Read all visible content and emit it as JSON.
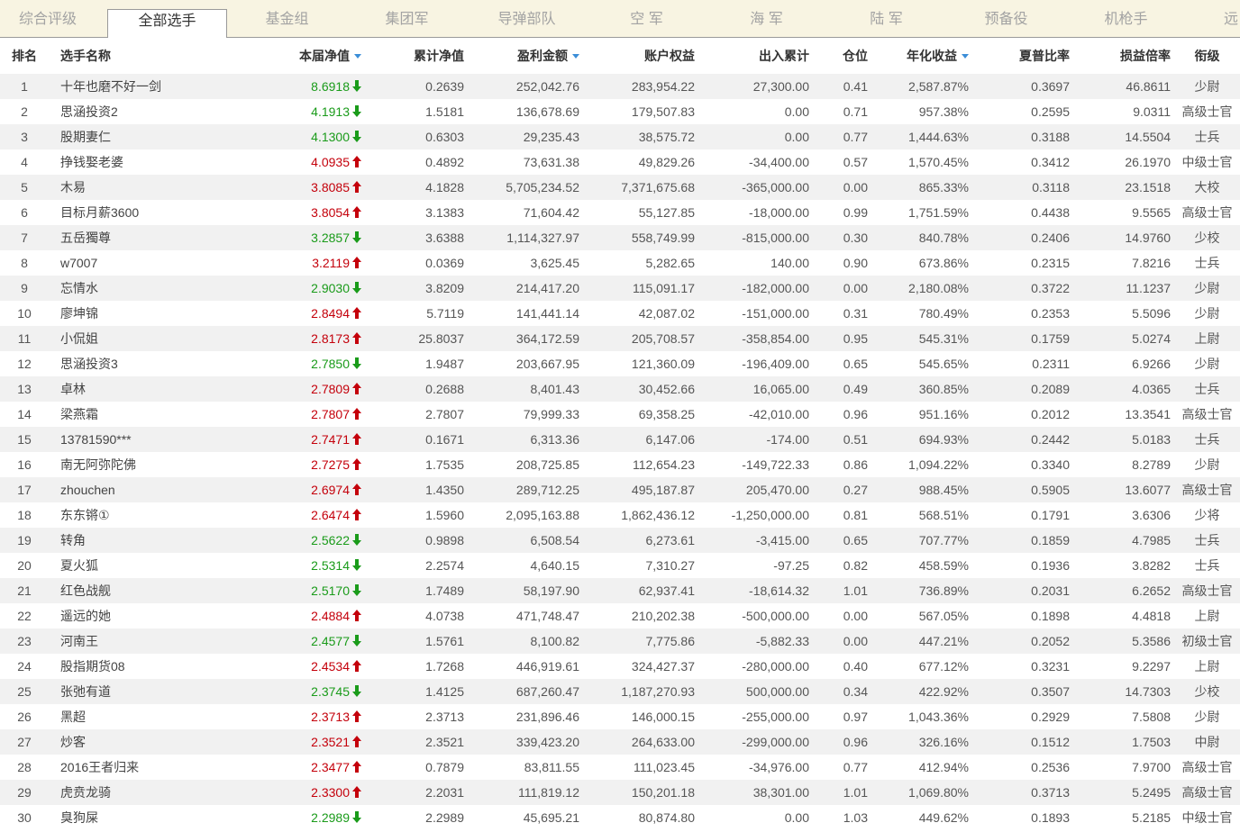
{
  "tabs": [
    {
      "label": "综合评级"
    },
    {
      "label": "全部选手",
      "active": true
    },
    {
      "label": "基金组"
    },
    {
      "label": "集团军"
    },
    {
      "label": "导弹部队"
    },
    {
      "label": "空 军"
    },
    {
      "label": "海 军"
    },
    {
      "label": "陆 军"
    },
    {
      "label": "预备役"
    },
    {
      "label": "机枪手"
    },
    {
      "label": "远"
    }
  ],
  "columns": [
    {
      "label": "排名"
    },
    {
      "label": "选手名称"
    },
    {
      "label": "本届净值",
      "sort": "desc"
    },
    {
      "label": "累计净值"
    },
    {
      "label": "盈利金额",
      "sort": "desc"
    },
    {
      "label": "账户权益"
    },
    {
      "label": "出入累计"
    },
    {
      "label": "仓位"
    },
    {
      "label": "年化收益",
      "sort": "desc"
    },
    {
      "label": "夏普比率"
    },
    {
      "label": "损益倍率"
    },
    {
      "label": "衔级"
    }
  ],
  "colors": {
    "up": "#c4000b",
    "down": "#1a9b1a",
    "sort_icon": "#3b8ed8",
    "tab_bar": "#f8f4e2"
  },
  "trend_icons": {
    "up": "arrow-up-icon",
    "down": "arrow-down-icon"
  },
  "sort_icon": "sort-desc-triangle-icon",
  "rows": [
    {
      "rank": "1",
      "name": "十年也磨不好一剑",
      "current_nav": "8.6918",
      "trend": "down",
      "cum_nav": "0.2639",
      "profit": "252,042.76",
      "equity": "283,954.22",
      "flow": "27,300.00",
      "position": "0.41",
      "annual": "2,587.87%",
      "sharpe": "0.3697",
      "pl_ratio": "46.8611",
      "title": "少尉"
    },
    {
      "rank": "2",
      "name": "思涵投资2",
      "current_nav": "4.1913",
      "trend": "down",
      "cum_nav": "1.5181",
      "profit": "136,678.69",
      "equity": "179,507.83",
      "flow": "0.00",
      "position": "0.71",
      "annual": "957.38%",
      "sharpe": "0.2595",
      "pl_ratio": "9.0311",
      "title": "高级士官"
    },
    {
      "rank": "3",
      "name": "股期妻仁",
      "current_nav": "4.1300",
      "trend": "down",
      "cum_nav": "0.6303",
      "profit": "29,235.43",
      "equity": "38,575.72",
      "flow": "0.00",
      "position": "0.77",
      "annual": "1,444.63%",
      "sharpe": "0.3188",
      "pl_ratio": "14.5504",
      "title": "士兵"
    },
    {
      "rank": "4",
      "name": "挣钱娶老婆",
      "current_nav": "4.0935",
      "trend": "up",
      "cum_nav": "0.4892",
      "profit": "73,631.38",
      "equity": "49,829.26",
      "flow": "-34,400.00",
      "position": "0.57",
      "annual": "1,570.45%",
      "sharpe": "0.3412",
      "pl_ratio": "26.1970",
      "title": "中级士官"
    },
    {
      "rank": "5",
      "name": "木易",
      "current_nav": "3.8085",
      "trend": "up",
      "cum_nav": "4.1828",
      "profit": "5,705,234.52",
      "equity": "7,371,675.68",
      "flow": "-365,000.00",
      "position": "0.00",
      "annual": "865.33%",
      "sharpe": "0.3118",
      "pl_ratio": "23.1518",
      "title": "大校"
    },
    {
      "rank": "6",
      "name": "目标月薪3600",
      "current_nav": "3.8054",
      "trend": "up",
      "cum_nav": "3.1383",
      "profit": "71,604.42",
      "equity": "55,127.85",
      "flow": "-18,000.00",
      "position": "0.99",
      "annual": "1,751.59%",
      "sharpe": "0.4438",
      "pl_ratio": "9.5565",
      "title": "高级士官"
    },
    {
      "rank": "7",
      "name": "五岳獨尊",
      "current_nav": "3.2857",
      "trend": "down",
      "cum_nav": "3.6388",
      "profit": "1,114,327.97",
      "equity": "558,749.99",
      "flow": "-815,000.00",
      "position": "0.30",
      "annual": "840.78%",
      "sharpe": "0.2406",
      "pl_ratio": "14.9760",
      "title": "少校"
    },
    {
      "rank": "8",
      "name": "w7007",
      "current_nav": "3.2119",
      "trend": "up",
      "cum_nav": "0.0369",
      "profit": "3,625.45",
      "equity": "5,282.65",
      "flow": "140.00",
      "position": "0.90",
      "annual": "673.86%",
      "sharpe": "0.2315",
      "pl_ratio": "7.8216",
      "title": "士兵"
    },
    {
      "rank": "9",
      "name": "忘情水",
      "current_nav": "2.9030",
      "trend": "down",
      "cum_nav": "3.8209",
      "profit": "214,417.20",
      "equity": "115,091.17",
      "flow": "-182,000.00",
      "position": "0.00",
      "annual": "2,180.08%",
      "sharpe": "0.3722",
      "pl_ratio": "11.1237",
      "title": "少尉"
    },
    {
      "rank": "10",
      "name": "廖坤锦",
      "current_nav": "2.8494",
      "trend": "up",
      "cum_nav": "5.7119",
      "profit": "141,441.14",
      "equity": "42,087.02",
      "flow": "-151,000.00",
      "position": "0.31",
      "annual": "780.49%",
      "sharpe": "0.2353",
      "pl_ratio": "5.5096",
      "title": "少尉"
    },
    {
      "rank": "11",
      "name": "小侃姐",
      "current_nav": "2.8173",
      "trend": "up",
      "cum_nav": "25.8037",
      "profit": "364,172.59",
      "equity": "205,708.57",
      "flow": "-358,854.00",
      "position": "0.95",
      "annual": "545.31%",
      "sharpe": "0.1759",
      "pl_ratio": "5.0274",
      "title": "上尉"
    },
    {
      "rank": "12",
      "name": "思涵投资3",
      "current_nav": "2.7850",
      "trend": "down",
      "cum_nav": "1.9487",
      "profit": "203,667.95",
      "equity": "121,360.09",
      "flow": "-196,409.00",
      "position": "0.65",
      "annual": "545.65%",
      "sharpe": "0.2311",
      "pl_ratio": "6.9266",
      "title": "少尉"
    },
    {
      "rank": "13",
      "name": "卓林",
      "current_nav": "2.7809",
      "trend": "up",
      "cum_nav": "0.2688",
      "profit": "8,401.43",
      "equity": "30,452.66",
      "flow": "16,065.00",
      "position": "0.49",
      "annual": "360.85%",
      "sharpe": "0.2089",
      "pl_ratio": "4.0365",
      "title": "士兵"
    },
    {
      "rank": "14",
      "name": "梁燕霜",
      "current_nav": "2.7807",
      "trend": "up",
      "cum_nav": "2.7807",
      "profit": "79,999.33",
      "equity": "69,358.25",
      "flow": "-42,010.00",
      "position": "0.96",
      "annual": "951.16%",
      "sharpe": "0.2012",
      "pl_ratio": "13.3541",
      "title": "高级士官"
    },
    {
      "rank": "15",
      "name": "13781590***",
      "current_nav": "2.7471",
      "trend": "up",
      "cum_nav": "0.1671",
      "profit": "6,313.36",
      "equity": "6,147.06",
      "flow": "-174.00",
      "position": "0.51",
      "annual": "694.93%",
      "sharpe": "0.2442",
      "pl_ratio": "5.0183",
      "title": "士兵"
    },
    {
      "rank": "16",
      "name": "南无阿弥陀佛",
      "current_nav": "2.7275",
      "trend": "up",
      "cum_nav": "1.7535",
      "profit": "208,725.85",
      "equity": "112,654.23",
      "flow": "-149,722.33",
      "position": "0.86",
      "annual": "1,094.22%",
      "sharpe": "0.3340",
      "pl_ratio": "8.2789",
      "title": "少尉"
    },
    {
      "rank": "17",
      "name": "zhouchen",
      "current_nav": "2.6974",
      "trend": "up",
      "cum_nav": "1.4350",
      "profit": "289,712.25",
      "equity": "495,187.87",
      "flow": "205,470.00",
      "position": "0.27",
      "annual": "988.45%",
      "sharpe": "0.5905",
      "pl_ratio": "13.6077",
      "title": "高级士官"
    },
    {
      "rank": "18",
      "name": "东东锵①",
      "current_nav": "2.6474",
      "trend": "up",
      "cum_nav": "1.5960",
      "profit": "2,095,163.88",
      "equity": "1,862,436.12",
      "flow": "-1,250,000.00",
      "position": "0.81",
      "annual": "568.51%",
      "sharpe": "0.1791",
      "pl_ratio": "3.6306",
      "title": "少将"
    },
    {
      "rank": "19",
      "name": "转角",
      "current_nav": "2.5622",
      "trend": "down",
      "cum_nav": "0.9898",
      "profit": "6,508.54",
      "equity": "6,273.61",
      "flow": "-3,415.00",
      "position": "0.65",
      "annual": "707.77%",
      "sharpe": "0.1859",
      "pl_ratio": "4.7985",
      "title": "士兵"
    },
    {
      "rank": "20",
      "name": "夏火狐",
      "current_nav": "2.5314",
      "trend": "down",
      "cum_nav": "2.2574",
      "profit": "4,640.15",
      "equity": "7,310.27",
      "flow": "-97.25",
      "position": "0.82",
      "annual": "458.59%",
      "sharpe": "0.1936",
      "pl_ratio": "3.8282",
      "title": "士兵"
    },
    {
      "rank": "21",
      "name": "红色战舰",
      "current_nav": "2.5170",
      "trend": "down",
      "cum_nav": "1.7489",
      "profit": "58,197.90",
      "equity": "62,937.41",
      "flow": "-18,614.32",
      "position": "1.01",
      "annual": "736.89%",
      "sharpe": "0.2031",
      "pl_ratio": "6.2652",
      "title": "高级士官"
    },
    {
      "rank": "22",
      "name": "遥远的她",
      "current_nav": "2.4884",
      "trend": "up",
      "cum_nav": "4.0738",
      "profit": "471,748.47",
      "equity": "210,202.38",
      "flow": "-500,000.00",
      "position": "0.00",
      "annual": "567.05%",
      "sharpe": "0.1898",
      "pl_ratio": "4.4818",
      "title": "上尉"
    },
    {
      "rank": "23",
      "name": "河南王",
      "current_nav": "2.4577",
      "trend": "down",
      "cum_nav": "1.5761",
      "profit": "8,100.82",
      "equity": "7,775.86",
      "flow": "-5,882.33",
      "position": "0.00",
      "annual": "447.21%",
      "sharpe": "0.2052",
      "pl_ratio": "5.3586",
      "title": "初级士官"
    },
    {
      "rank": "24",
      "name": "股指期货08",
      "current_nav": "2.4534",
      "trend": "up",
      "cum_nav": "1.7268",
      "profit": "446,919.61",
      "equity": "324,427.37",
      "flow": "-280,000.00",
      "position": "0.40",
      "annual": "677.12%",
      "sharpe": "0.3231",
      "pl_ratio": "9.2297",
      "title": "上尉"
    },
    {
      "rank": "25",
      "name": "张弛有道",
      "current_nav": "2.3745",
      "trend": "down",
      "cum_nav": "1.4125",
      "profit": "687,260.47",
      "equity": "1,187,270.93",
      "flow": "500,000.00",
      "position": "0.34",
      "annual": "422.92%",
      "sharpe": "0.3507",
      "pl_ratio": "14.7303",
      "title": "少校"
    },
    {
      "rank": "26",
      "name": "黑超",
      "current_nav": "2.3713",
      "trend": "up",
      "cum_nav": "2.3713",
      "profit": "231,896.46",
      "equity": "146,000.15",
      "flow": "-255,000.00",
      "position": "0.97",
      "annual": "1,043.36%",
      "sharpe": "0.2929",
      "pl_ratio": "7.5808",
      "title": "少尉"
    },
    {
      "rank": "27",
      "name": "炒客",
      "current_nav": "2.3521",
      "trend": "up",
      "cum_nav": "2.3521",
      "profit": "339,423.20",
      "equity": "264,633.00",
      "flow": "-299,000.00",
      "position": "0.96",
      "annual": "326.16%",
      "sharpe": "0.1512",
      "pl_ratio": "1.7503",
      "title": "中尉"
    },
    {
      "rank": "28",
      "name": "2016王者归来",
      "current_nav": "2.3477",
      "trend": "up",
      "cum_nav": "0.7879",
      "profit": "83,811.55",
      "equity": "111,023.45",
      "flow": "-34,976.00",
      "position": "0.77",
      "annual": "412.94%",
      "sharpe": "0.2536",
      "pl_ratio": "7.9700",
      "title": "高级士官"
    },
    {
      "rank": "29",
      "name": "虎贲龙骑",
      "current_nav": "2.3300",
      "trend": "up",
      "cum_nav": "2.2031",
      "profit": "111,819.12",
      "equity": "150,201.18",
      "flow": "38,301.00",
      "position": "1.01",
      "annual": "1,069.80%",
      "sharpe": "0.3713",
      "pl_ratio": "5.2495",
      "title": "高级士官"
    },
    {
      "rank": "30",
      "name": "臭狗屎",
      "current_nav": "2.2989",
      "trend": "down",
      "cum_nav": "2.2989",
      "profit": "45,695.21",
      "equity": "80,874.80",
      "flow": "0.00",
      "position": "1.03",
      "annual": "449.62%",
      "sharpe": "0.1893",
      "pl_ratio": "5.2185",
      "title": "中级士官"
    }
  ]
}
